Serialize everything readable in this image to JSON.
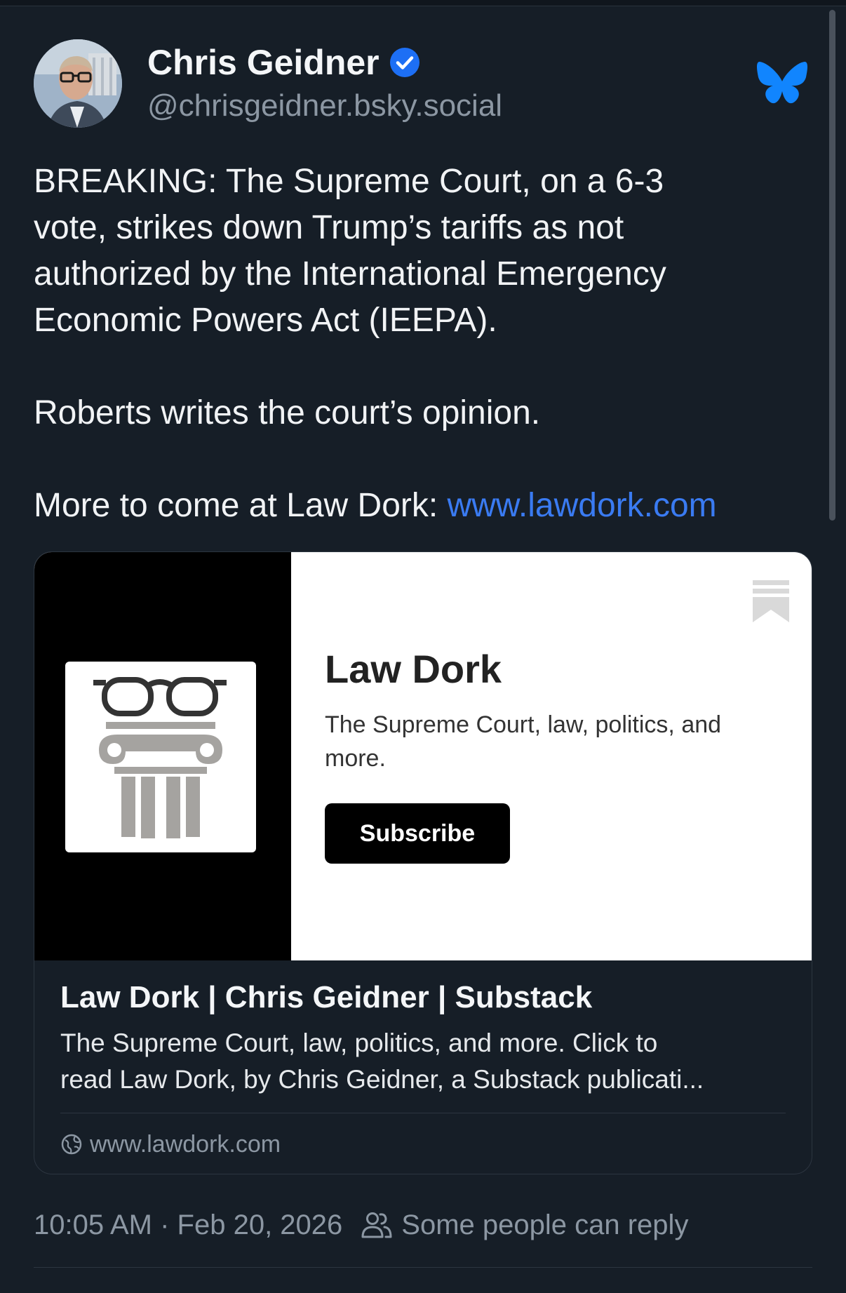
{
  "author": {
    "display_name": "Chris Geidner",
    "handle": "@chrisgeidner.bsky.social",
    "verified": true
  },
  "post": {
    "paragraph_1_lines": [
      "BREAKING: The Supreme Court, on a 6-3",
      "vote, strikes down Trump’s tariffs as not",
      "authorized by the International Emergency",
      "Economic Powers Act (IEEPA)."
    ],
    "paragraph_2": "Roberts writes the court’s opinion.",
    "paragraph_3_prefix": "More to come at Law Dork: ",
    "paragraph_3_link": "www.lawdork.com"
  },
  "link_card": {
    "image": {
      "publication_name": "Law Dork",
      "publication_description": "The Supreme Court, law, politics, and more.",
      "subscribe_label": "Subscribe"
    },
    "title": "Law Dork | Chris Geidner | Substack",
    "description_lines": [
      "The Supreme Court, law, politics, and more. Click to",
      "read Law Dork, by Chris Geidner, a Substack publicati..."
    ],
    "domain": "www.lawdork.com"
  },
  "meta": {
    "timestamp": "10:05 AM · Feb 20, 2026",
    "reply_setting": "Some people can reply"
  },
  "colors": {
    "background": "#161e27",
    "link": "#3a7bf2",
    "bluesky_blue": "#1185fe",
    "verified_blue": "#1d6ff5",
    "muted_text": "#8c97a3"
  },
  "icons": [
    "verified-badge-icon",
    "bluesky-butterfly-icon",
    "bookmark-icon",
    "globe-icon",
    "people-icon"
  ]
}
